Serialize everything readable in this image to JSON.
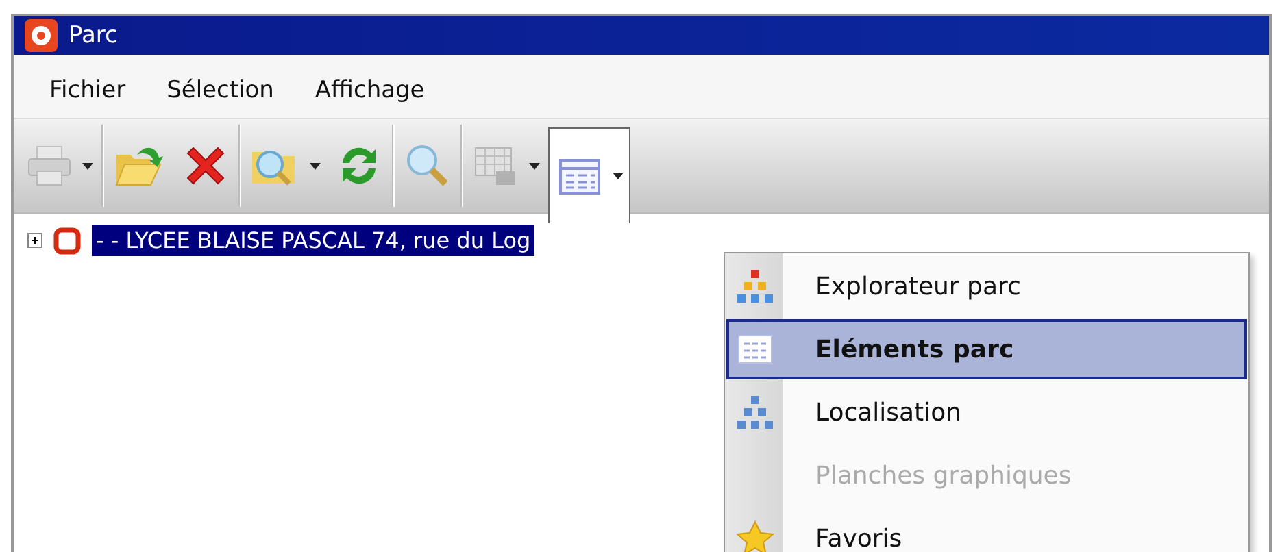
{
  "window": {
    "title": "Parc"
  },
  "menu_bar": [
    {
      "label": "Fichier"
    },
    {
      "label": "Sélection"
    },
    {
      "label": "Affichage"
    }
  ],
  "toolbar": [
    {
      "kind": "print",
      "dropdown": true,
      "disabled": true,
      "pressed": false
    },
    {
      "kind": "open",
      "dropdown": false,
      "disabled": false,
      "pressed": false
    },
    {
      "kind": "delete",
      "dropdown": false,
      "disabled": false,
      "pressed": false
    },
    {
      "kind": "find",
      "dropdown": true,
      "disabled": false,
      "pressed": false
    },
    {
      "kind": "refresh",
      "dropdown": false,
      "disabled": false,
      "pressed": false
    },
    {
      "kind": "zoom",
      "dropdown": false,
      "disabled": false,
      "pressed": false
    },
    {
      "kind": "grid",
      "dropdown": true,
      "disabled": true,
      "pressed": false
    },
    {
      "kind": "table",
      "dropdown": true,
      "disabled": false,
      "pressed": true
    }
  ],
  "tree": [
    {
      "label": "- - LYCEE BLAISE PASCAL 74, rue du Log",
      "expanded": false,
      "selected": true
    }
  ],
  "dropdown_menu": [
    {
      "kind": "explorer",
      "label": "Explorateur parc",
      "selected": false,
      "default": false,
      "disabled": false
    },
    {
      "kind": "table",
      "label": "Eléments parc",
      "selected": true,
      "default": true,
      "disabled": false
    },
    {
      "kind": "location",
      "label": "Localisation",
      "selected": false,
      "default": false,
      "disabled": false
    },
    {
      "kind": "none",
      "label": "Planches graphiques",
      "selected": false,
      "default": false,
      "disabled": true
    },
    {
      "kind": "star",
      "label": "Favoris",
      "selected": false,
      "default": false,
      "disabled": false
    }
  ]
}
